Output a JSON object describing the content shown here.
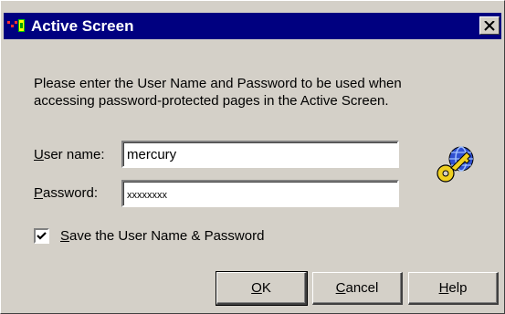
{
  "window": {
    "title": "Active Screen",
    "titlebar_color": "#000080",
    "face_color": "#d4d0c8"
  },
  "prompt": {
    "line1": "Please enter the User Name and Password to be used when",
    "line2": "accessing password-protected pages in the Active Screen."
  },
  "fields": {
    "username": {
      "label_accel": "U",
      "label_rest": "ser name:",
      "value": "mercury"
    },
    "password": {
      "label_accel": "P",
      "label_rest": "assword:",
      "value": "xxxxxxxx"
    }
  },
  "save_checkbox": {
    "checked": true,
    "label_accel": "S",
    "label_rest": "ave the User Name & Password"
  },
  "buttons": {
    "ok": {
      "accel": "O",
      "rest": "K"
    },
    "cancel": {
      "accel": "C",
      "rest": "ancel"
    },
    "help": {
      "accel": "H",
      "rest": "elp"
    }
  },
  "icons": {
    "app": "mercury-app-icon",
    "close": "close-icon",
    "key": "globe-key-icon",
    "check": "checkmark-icon"
  }
}
